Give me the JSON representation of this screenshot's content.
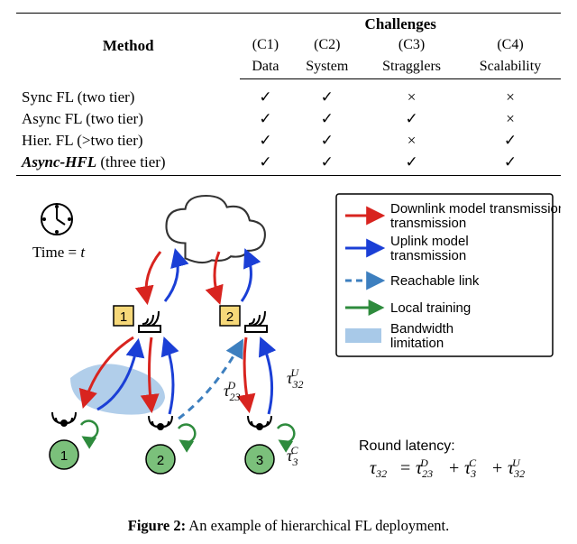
{
  "table": {
    "head_method": "Method",
    "head_challenges": "Challenges",
    "cols": [
      {
        "code": "(C1)",
        "name": "Data"
      },
      {
        "code": "(C2)",
        "name": "System"
      },
      {
        "code": "(C3)",
        "name": "Stragglers"
      },
      {
        "code": "(C4)",
        "name": "Scalability"
      }
    ],
    "chk": "✓",
    "x": "×",
    "rows": [
      {
        "method": "Sync FL (two tier)",
        "bold": false,
        "marks": [
          "y",
          "y",
          "n",
          "n"
        ]
      },
      {
        "method": "Async FL (two tier)",
        "bold": false,
        "marks": [
          "y",
          "y",
          "y",
          "n"
        ]
      },
      {
        "method": "Hier. FL (>two tier)",
        "bold": false,
        "marks": [
          "y",
          "y",
          "n",
          "y"
        ]
      },
      {
        "method": "Async-HFL (three tier)",
        "bold": true,
        "marks": [
          "y",
          "y",
          "y",
          "y"
        ]
      }
    ]
  },
  "legend": {
    "title": "",
    "items": [
      {
        "key": "downlink",
        "label": "Downlink model transmission"
      },
      {
        "key": "uplink",
        "label": "Uplink model transmission"
      },
      {
        "key": "reachable",
        "label": "Reachable link"
      },
      {
        "key": "local",
        "label": "Local training"
      },
      {
        "key": "bw",
        "label": "Bandwidth limitation"
      }
    ]
  },
  "diagram": {
    "time_label": "Time = t",
    "gw1": "1",
    "gw2": "2",
    "dev1": "1",
    "dev2": "2",
    "dev3": "3",
    "tauD": "τ",
    "tauD_sub": "23",
    "tauD_sup": "D",
    "tauU": "τ",
    "tauU_sub": "32",
    "tauU_sup": "U",
    "tauC": "τ",
    "tauC_sub": "3",
    "tauC_sup": "C",
    "latency_title": "Round latency:",
    "latency_eq": "τ₃₂ = τ₂₃ᴰ + τ₃ᶜ + τ₃₂ᵁ"
  },
  "caption_label": "Figure 2:",
  "caption_text": " An example of hierarchical FL deployment."
}
